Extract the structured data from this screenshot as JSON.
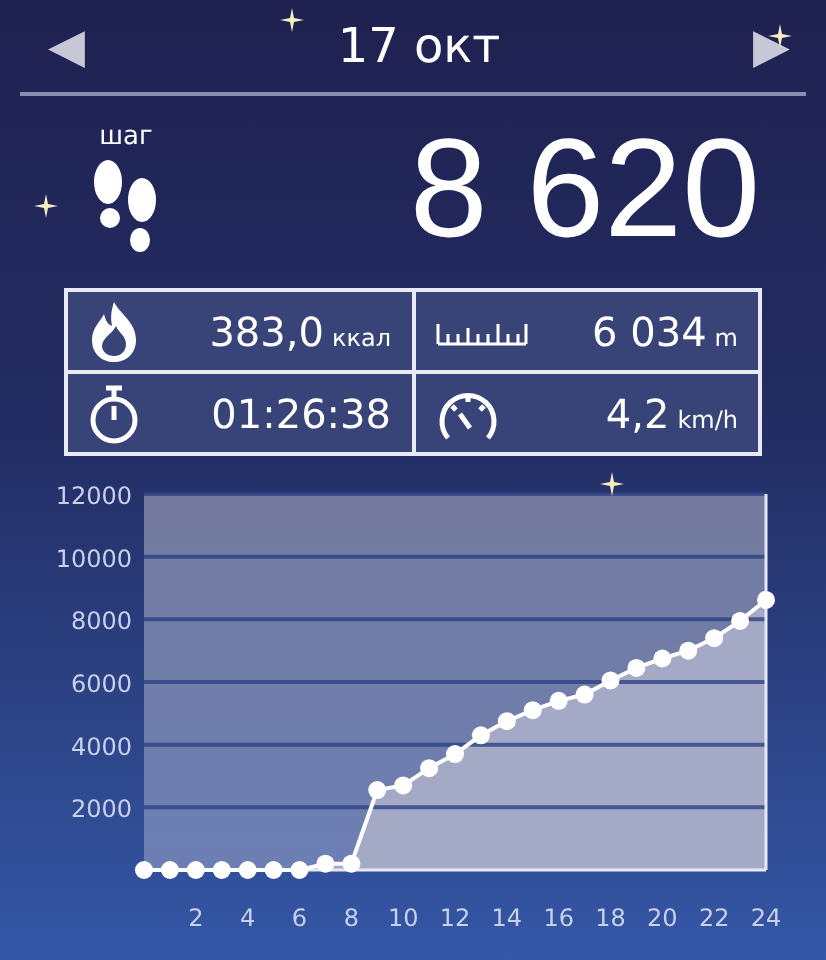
{
  "header": {
    "prev": "◀",
    "date": "17 окт",
    "next": "▶"
  },
  "steps": {
    "label": "шаг",
    "value": "8 620"
  },
  "stats": [
    {
      "kind": "calories",
      "value": "383,0",
      "unit": "ккал"
    },
    {
      "kind": "distance",
      "value": "6 034",
      "unit": "m"
    },
    {
      "kind": "duration",
      "value": "01:26:38"
    },
    {
      "kind": "speed",
      "value": "4,2",
      "unit": "km/h"
    }
  ],
  "chart": {
    "chart_data": {
      "type": "area",
      "x": [
        0,
        1,
        2,
        3,
        4,
        5,
        6,
        7,
        8,
        9,
        10,
        11,
        12,
        13,
        14,
        15,
        16,
        17,
        18,
        19,
        20,
        21,
        22,
        23,
        24
      ],
      "series": [
        {
          "color": "#ffffff",
          "values": [
            0,
            0,
            0,
            0,
            0,
            0,
            0,
            200,
            200,
            2550,
            2700,
            3250,
            3700,
            4300,
            4750,
            5100,
            5400,
            5600,
            6050,
            6450,
            6750,
            7000,
            7400,
            7950,
            8620
          ]
        }
      ],
      "xlim": [
        0,
        24
      ],
      "ylim": [
        0,
        12000
      ],
      "xticks": [
        2,
        4,
        6,
        8,
        10,
        12,
        14,
        16,
        18,
        20,
        22,
        24
      ],
      "yticks": [
        2000,
        4000,
        6000,
        8000,
        10000,
        12000
      ],
      "grid": true
    }
  }
}
